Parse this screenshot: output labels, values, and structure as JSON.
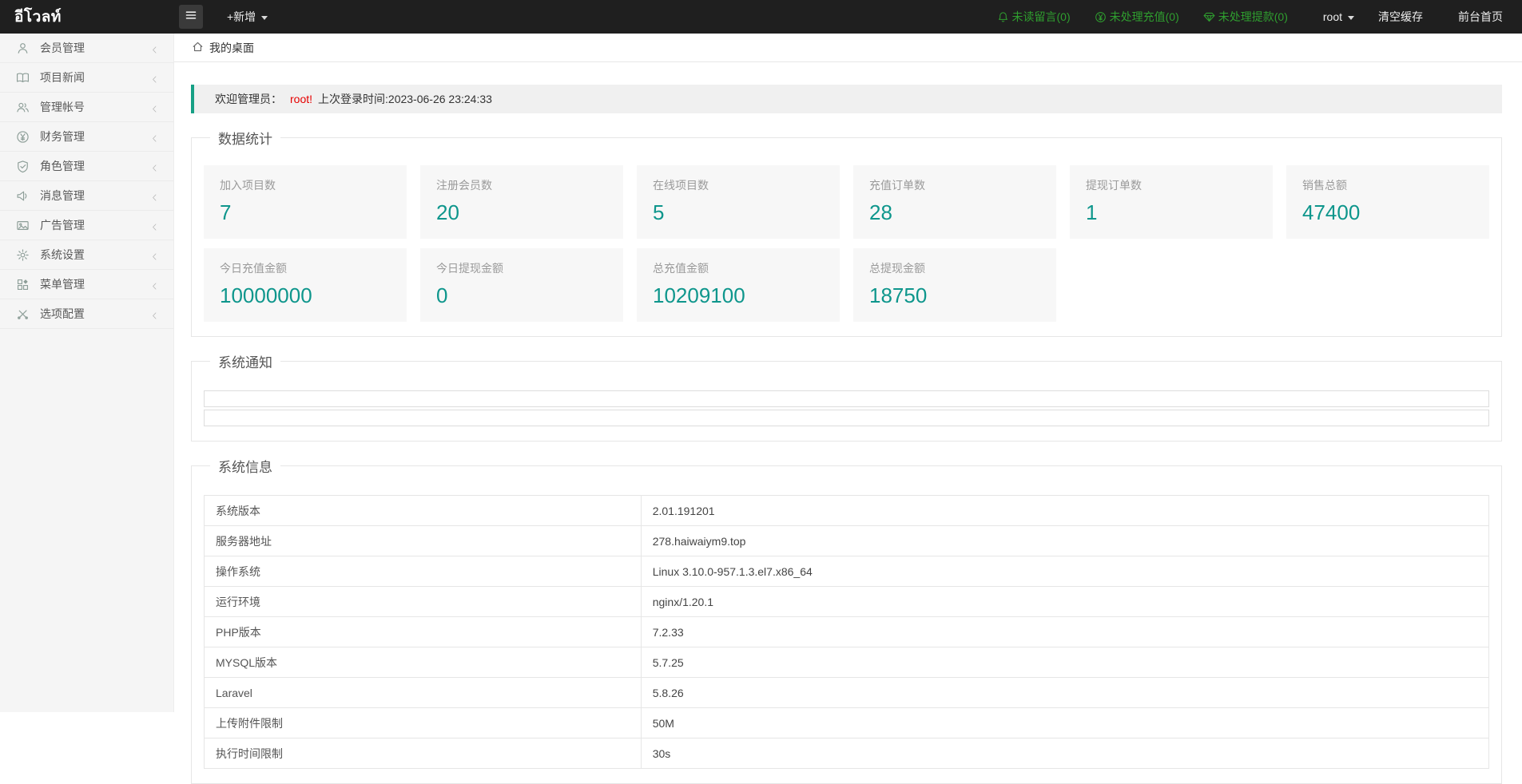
{
  "colors": {
    "header_bg": "#1f1f1f",
    "accent_green": "#2f9e2f",
    "stat_teal": "#0e968c",
    "welcome_border": "#16a085",
    "danger_red": "#e60000"
  },
  "header": {
    "logo": "อีโวลท์",
    "add_label": "+新增",
    "notifications": [
      {
        "id": "unread-messages-link",
        "icon": "bell-icon",
        "label": "未读留言(0)"
      },
      {
        "id": "pending-recharge-link",
        "icon": "yen-coin-icon",
        "label": "未处理充值(0)"
      },
      {
        "id": "pending-withdraw-link",
        "icon": "gem-icon",
        "label": "未处理提款(0)"
      }
    ],
    "user": "root",
    "clear_cache": "清空缓存",
    "front_home": "前台首页"
  },
  "sidebar": {
    "items": [
      {
        "id": "member",
        "icon": "user-icon",
        "label": "会员管理"
      },
      {
        "id": "news",
        "icon": "book-icon",
        "label": "项目新闻"
      },
      {
        "id": "account",
        "icon": "users-icon",
        "label": "管理帐号"
      },
      {
        "id": "finance",
        "icon": "yen-coin-icon",
        "label": "财务管理"
      },
      {
        "id": "role",
        "icon": "shield-check-icon",
        "label": "角色管理"
      },
      {
        "id": "message",
        "icon": "speaker-icon",
        "label": "消息管理"
      },
      {
        "id": "ad",
        "icon": "image-icon",
        "label": "广告管理"
      },
      {
        "id": "system",
        "icon": "gear-icon",
        "label": "系统设置"
      },
      {
        "id": "menu",
        "icon": "grid-icon",
        "label": "菜单管理"
      },
      {
        "id": "option",
        "icon": "tools-icon",
        "label": "选项配置"
      }
    ]
  },
  "breadcrumb": {
    "label": "我的桌面"
  },
  "welcome": {
    "prefix": "欢迎管理员：",
    "user": "root!",
    "suffix": "上次登录时间:2023-06-26 23:24:33"
  },
  "stats": {
    "title": "数据统计",
    "cards": [
      {
        "label": "加入项目数",
        "value": "7"
      },
      {
        "label": "注册会员数",
        "value": "20"
      },
      {
        "label": "在线项目数",
        "value": "5"
      },
      {
        "label": "充值订单数",
        "value": "28"
      },
      {
        "label": "提现订单数",
        "value": "1"
      },
      {
        "label": "销售总额",
        "value": "47400"
      },
      {
        "label": "今日充值金额",
        "value": "10000000"
      },
      {
        "label": "今日提现金额",
        "value": "0"
      },
      {
        "label": "总充值金额",
        "value": "10209100"
      },
      {
        "label": "总提现金额",
        "value": "18750"
      }
    ]
  },
  "notice": {
    "title": "系统通知",
    "rows": [
      "",
      ""
    ]
  },
  "sysinfo": {
    "title": "系统信息",
    "rows": [
      {
        "label": "系统版本",
        "value": "2.01.191201"
      },
      {
        "label": "服务器地址",
        "value": "278.haiwaiym9.top"
      },
      {
        "label": "操作系统",
        "value": "Linux 3.10.0-957.1.3.el7.x86_64"
      },
      {
        "label": "运行环境",
        "value": "nginx/1.20.1"
      },
      {
        "label": "PHP版本",
        "value": "7.2.33"
      },
      {
        "label": "MYSQL版本",
        "value": "5.7.25"
      },
      {
        "label": "Laravel",
        "value": "5.8.26"
      },
      {
        "label": "上传附件限制",
        "value": "50M"
      },
      {
        "label": "执行时间限制",
        "value": "30s"
      }
    ]
  }
}
